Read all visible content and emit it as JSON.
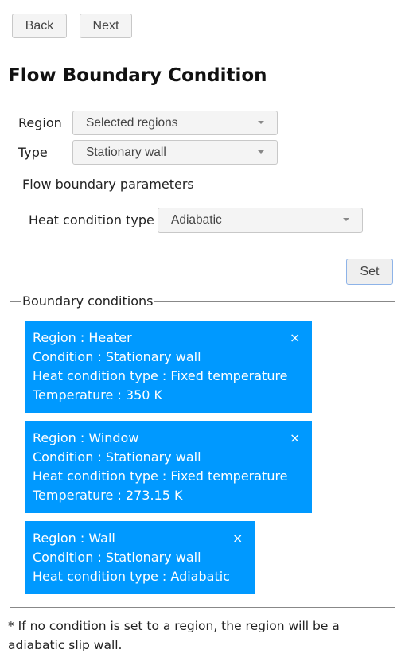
{
  "nav": {
    "back_label": "Back",
    "next_label": "Next"
  },
  "page_title": "Flow Boundary Condition",
  "form": {
    "region_label": "Region",
    "region_value": "Selected regions",
    "type_label": "Type",
    "type_value": "Stationary wall"
  },
  "parameters": {
    "legend": "Flow boundary parameters",
    "heat_label": "Heat condition type",
    "heat_value": "Adiabatic"
  },
  "set_label": "Set",
  "boundary": {
    "legend": "Boundary conditions",
    "close_glyph": "×",
    "items": [
      {
        "lines": [
          "Region : Heater",
          "Condition : Stationary wall",
          "Heat condition type : Fixed temperature",
          "Temperature : 350 K"
        ]
      },
      {
        "lines": [
          "Region : Window",
          "Condition : Stationary wall",
          "Heat condition type : Fixed temperature",
          "Temperature : 273.15 K"
        ]
      },
      {
        "lines": [
          "Region : Wall",
          "Condition : Stationary wall",
          "Heat condition type : Adiabatic"
        ]
      }
    ]
  },
  "note": "* If no condition is set to a region, the region will be a adiabatic slip wall.",
  "colors": {
    "card_bg": "#0099ff",
    "card_text": "#ffffff"
  }
}
